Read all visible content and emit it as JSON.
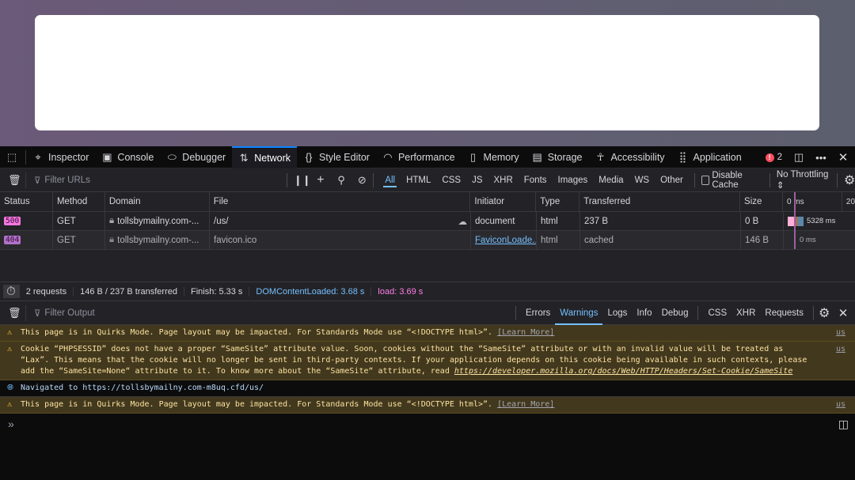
{
  "tabs": [
    {
      "label": "Inspector",
      "icon": "inspector-icon"
    },
    {
      "label": "Console",
      "icon": "console-icon"
    },
    {
      "label": "Debugger",
      "icon": "debugger-icon"
    },
    {
      "label": "Network",
      "icon": "network-icon",
      "active": true
    },
    {
      "label": "Style Editor",
      "icon": "style-editor-icon"
    },
    {
      "label": "Performance",
      "icon": "performance-icon"
    },
    {
      "label": "Memory",
      "icon": "memory-icon"
    },
    {
      "label": "Storage",
      "icon": "storage-icon"
    },
    {
      "label": "Accessibility",
      "icon": "accessibility-icon"
    },
    {
      "label": "Application",
      "icon": "application-icon"
    }
  ],
  "error_count": "2",
  "network": {
    "filter_placeholder": "Filter URLs",
    "types": [
      "All",
      "HTML",
      "CSS",
      "JS",
      "XHR",
      "Fonts",
      "Images",
      "Media",
      "WS",
      "Other"
    ],
    "disable_cache": "Disable Cache",
    "throttling": "No Throttling",
    "columns": [
      "Status",
      "Method",
      "Domain",
      "File",
      "Initiator",
      "Type",
      "Transferred",
      "Size",
      "0 ms",
      "20"
    ],
    "rows": [
      {
        "status": "500",
        "method": "GET",
        "domain": "tollsbymailny.com-...",
        "file": "/us/",
        "initiator": "document",
        "type": "html",
        "transferred": "237 B",
        "size": "0 B",
        "timing": "5328 ms"
      },
      {
        "status": "404",
        "method": "GET",
        "domain": "tollsbymailny.com-...",
        "file": "favicon.ico",
        "initiator": "FaviconLoade...",
        "type": "html",
        "transferred": "cached",
        "size": "146 B",
        "timing": "0 ms"
      }
    ],
    "summary": {
      "requests": "2 requests",
      "transferred": "146 B / 237 B transferred",
      "finish": "Finish: 5.33 s",
      "dcl": "DOMContentLoaded: 3.68 s",
      "load": "load: 3.69 s"
    }
  },
  "console": {
    "filter_placeholder": "Filter Output",
    "levels": [
      "Errors",
      "Warnings",
      "Logs",
      "Info",
      "Debug"
    ],
    "extra": [
      "CSS",
      "XHR",
      "Requests"
    ],
    "messages": [
      {
        "text": "This page is in Quirks Mode. Page layout may be impacted. For Standards Mode use “<!DOCTYPE html>”.",
        "link": "[Learn More]",
        "src": "us"
      },
      {
        "text": "Cookie “PHPSESSID” does not have a proper “SameSite” attribute value. Soon, cookies without the “SameSite” attribute or with an invalid value will be treated as “Lax”. This means that the cookie will no longer be sent in third-party contexts. If your application depends on this cookie being available in such contexts, please add the “SameSite=None“ attribute to it. To know more about the “SameSite“ attribute, read",
        "link": "https://developer.mozilla.org/docs/Web/HTTP/Headers/Set-Cookie/SameSite",
        "src": "us"
      },
      {
        "text": "Navigated to https://tollsbymailny.com-m8uq.cfd/us/"
      },
      {
        "text": "This page is in Quirks Mode. Page layout may be impacted. For Standards Mode use “<!DOCTYPE html>”.",
        "link": "[Learn More]",
        "src": "us"
      }
    ],
    "prompt": "»"
  }
}
